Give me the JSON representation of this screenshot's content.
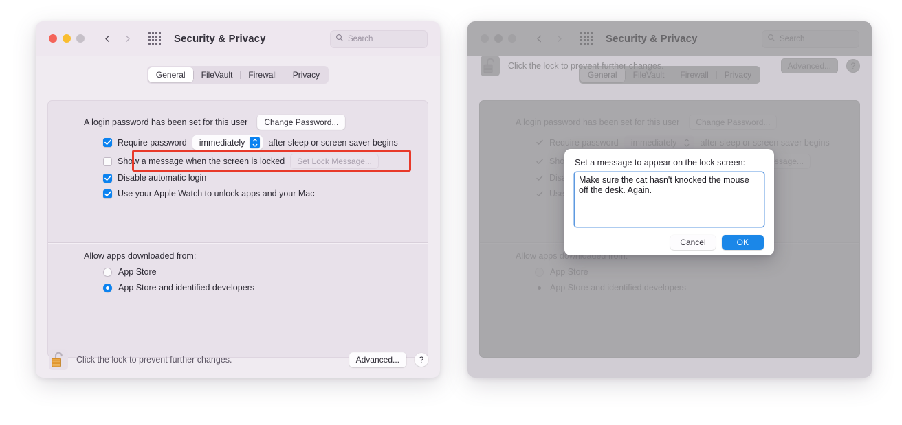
{
  "window_title": "Security & Privacy",
  "search": {
    "placeholder": "Search",
    "icon": "search-icon"
  },
  "icons": {
    "grid": "grid-icon",
    "back": "chevron-left-icon",
    "forward": "chevron-right-icon",
    "lock": "open-padlock-icon"
  },
  "tabs": [
    {
      "label": "General",
      "selected": true
    },
    {
      "label": "FileVault",
      "selected": false
    },
    {
      "label": "Firewall",
      "selected": false
    },
    {
      "label": "Privacy",
      "selected": false
    }
  ],
  "general": {
    "login_password_text": "A login password has been set for this user",
    "change_password_label": "Change Password...",
    "require_password": {
      "label": "Require password",
      "checked": true,
      "interval_value": "immediately",
      "suffix": "after sleep or screen saver begins"
    },
    "show_message": {
      "label": "Show a message when the screen is locked",
      "checked_left": false,
      "checked_right": true,
      "button_label": "Set Lock Message..."
    },
    "disable_auto_login": {
      "label": "Disable automatic login",
      "checked": true
    },
    "apple_watch": {
      "label": "Use your Apple Watch to unlock apps and your Mac",
      "checked": true
    }
  },
  "allow_apps": {
    "heading": "Allow apps downloaded from:",
    "options": [
      {
        "label": "App Store",
        "selected": false
      },
      {
        "label": "App Store and identified developers",
        "selected": true
      }
    ]
  },
  "footer": {
    "lock_text": "Click the lock to prevent further changes.",
    "advanced_label": "Advanced...",
    "help_label": "?"
  },
  "dialog": {
    "prompt": "Set a message to appear on the lock screen:",
    "message_value": "Make sure the cat hasn't knocked the mouse off the desk. Again.",
    "cancel_label": "Cancel",
    "ok_label": "OK"
  },
  "colors": {
    "accent_blue": "#0b82f0",
    "ok_button_blue": "#1b87e8",
    "highlight_red": "#e8392a",
    "window_bg": "#f0ebf1",
    "panel_bg": "#e8e1ea",
    "traffic_red": "#f4645a",
    "traffic_yellow": "#f9bd30",
    "traffic_green": "#c6c0c8",
    "lock_gold": "#e8a33d"
  }
}
